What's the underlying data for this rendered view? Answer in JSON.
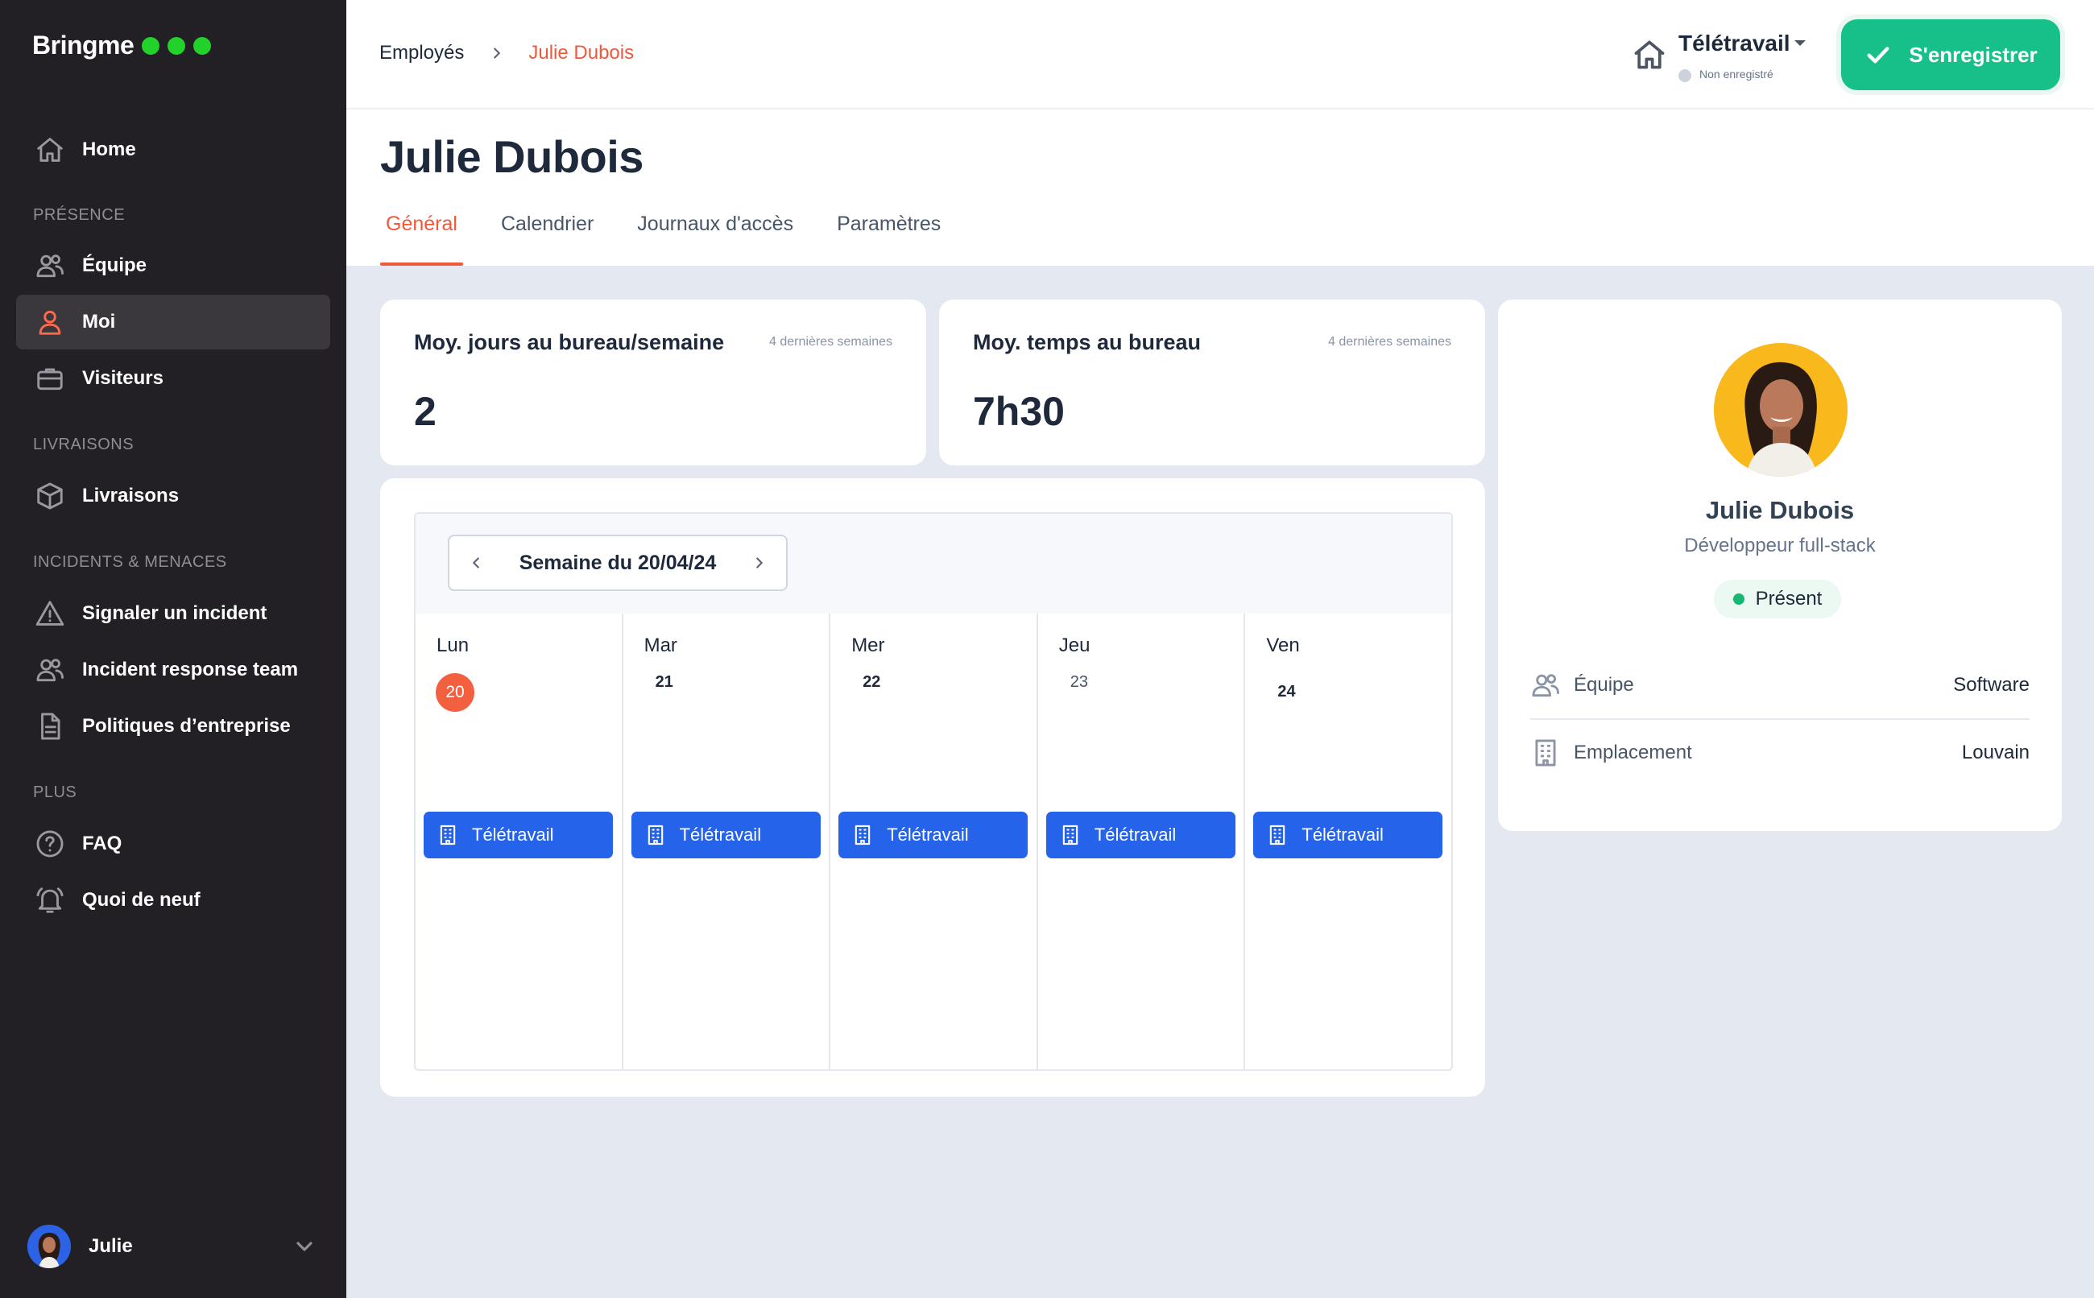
{
  "brand": {
    "name": "Bringme",
    "dot_color": "#22d12a"
  },
  "sidebar": {
    "home": {
      "label": "Home",
      "icon": "home-icon"
    },
    "sections": [
      {
        "title": "PRÉSENCE",
        "items": [
          {
            "label": "Équipe",
            "icon": "users-icon"
          },
          {
            "label": "Moi",
            "icon": "user-icon",
            "active": true
          },
          {
            "label": "Visiteurs",
            "icon": "briefcase-icon"
          }
        ]
      },
      {
        "title": "LIVRAISONS",
        "items": [
          {
            "label": "Livraisons",
            "icon": "package-icon"
          }
        ]
      },
      {
        "title": "INCIDENTS & MENACES",
        "items": [
          {
            "label": "Signaler un incident",
            "icon": "warning-icon"
          },
          {
            "label": "Incident response team",
            "icon": "users-icon"
          },
          {
            "label": "Politiques d’entreprise",
            "icon": "document-icon"
          }
        ]
      },
      {
        "title": "PLUS",
        "items": [
          {
            "label": "FAQ",
            "icon": "help-icon"
          },
          {
            "label": "Quoi de neuf",
            "icon": "bell-icon"
          }
        ]
      }
    ],
    "user": {
      "name": "Julie"
    }
  },
  "breadcrumb": {
    "parent": "Employés",
    "current": "Julie Dubois"
  },
  "status": {
    "title": "Télétravail",
    "subtitle": "Non enregistré"
  },
  "checkin": {
    "label": "S'enregistrer",
    "color": "#17c088"
  },
  "page": {
    "title": "Julie Dubois"
  },
  "tabs": [
    {
      "label": "Général",
      "active": true
    },
    {
      "label": "Calendrier"
    },
    {
      "label": "Journaux d'accès"
    },
    {
      "label": "Paramètres"
    }
  ],
  "stats": [
    {
      "title": "Moy. jours au bureau/semaine",
      "note": "4 dernières semaines",
      "value": "2"
    },
    {
      "title": "Moy. temps au bureau",
      "note": "4 dernières semaines",
      "value": "7h30"
    }
  ],
  "calendar": {
    "week_label": "Semaine du 20/04/24",
    "days": [
      {
        "name": "Lun",
        "date": "20",
        "today": true,
        "event": "Télétravail"
      },
      {
        "name": "Mar",
        "date": "21",
        "event": "Télétravail"
      },
      {
        "name": "Mer",
        "date": "22",
        "event": "Télétravail"
      },
      {
        "name": "Jeu",
        "date": "23",
        "light": true,
        "event": "Télétravail"
      },
      {
        "name": "Ven",
        "date": "24",
        "event": "Télétravail"
      }
    ],
    "event_color": "#2563eb",
    "today_color": "#f2603f"
  },
  "profile": {
    "name": "Julie Dubois",
    "role": "Développeur full-stack",
    "presence": "Présent",
    "team_label": "Équipe",
    "team_value": "Software",
    "location_label": "Emplacement",
    "location_value": "Louvain"
  },
  "accent": "#f0583c"
}
